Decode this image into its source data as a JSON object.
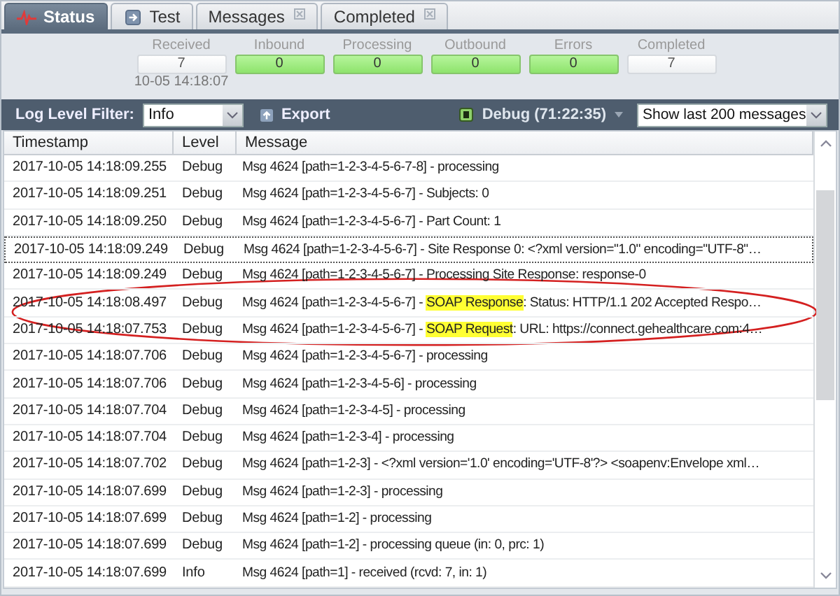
{
  "tabs": [
    {
      "label": "Status",
      "kind": "status",
      "closable": false,
      "selected": true
    },
    {
      "label": "Test",
      "kind": "test",
      "closable": false,
      "selected": false
    },
    {
      "label": "Messages",
      "kind": "plain",
      "closable": true,
      "selected": false
    },
    {
      "label": "Completed",
      "kind": "plain",
      "closable": true,
      "selected": false
    }
  ],
  "counters": [
    {
      "label": "Received",
      "value": "7",
      "highlighted": false,
      "time": "10-05 14:18:07"
    },
    {
      "label": "Inbound",
      "value": "0",
      "highlighted": true
    },
    {
      "label": "Processing",
      "value": "0",
      "highlighted": true
    },
    {
      "label": "Outbound",
      "value": "0",
      "highlighted": true
    },
    {
      "label": "Errors",
      "value": "0",
      "highlighted": true
    },
    {
      "label": "Completed",
      "value": "7",
      "highlighted": false
    }
  ],
  "toolbar": {
    "filter_label": "Log Level Filter:",
    "filter_value": "Info",
    "export_label": "Export",
    "debug_label": "Debug (71:22:35)",
    "limit_value": "Show last 200 messages"
  },
  "table": {
    "columns": [
      "Timestamp",
      "Level",
      "Message"
    ],
    "rows": [
      {
        "timestamp": "2017-10-05 14:18:09.255",
        "level": "Debug",
        "message": "Msg 4624 [path=1-2-3-4-5-6-7-8] - processing",
        "focused": false
      },
      {
        "timestamp": "2017-10-05 14:18:09.251",
        "level": "Debug",
        "message": "Msg 4624 [path=1-2-3-4-5-6-7] - Subjects: 0",
        "focused": false
      },
      {
        "timestamp": "2017-10-05 14:18:09.250",
        "level": "Debug",
        "message": "Msg 4624 [path=1-2-3-4-5-6-7] - Part Count: 1",
        "focused": false
      },
      {
        "timestamp": "2017-10-05 14:18:09.249",
        "level": "Debug",
        "message": "Msg 4624 [path=1-2-3-4-5-6-7] - Site Response 0: <?xml version=\"1.0\" encoding=\"UTF-8\"…",
        "focused": true
      },
      {
        "timestamp": "2017-10-05 14:18:09.249",
        "level": "Debug",
        "message": "Msg 4624 [path=1-2-3-4-5-6-7] - Processing Site Response: response-0",
        "focused": false
      },
      {
        "timestamp": "2017-10-05 14:18:08.497",
        "level": "Debug",
        "message": "Msg 4624 [path=1-2-3-4-5-6-7] - ",
        "highlight": "SOAP Response",
        "message_end": ": Status: HTTP/1.1 202 Accepted Respo…",
        "focused": false
      },
      {
        "timestamp": "2017-10-05 14:18:07.753",
        "level": "Debug",
        "message": "Msg 4624 [path=1-2-3-4-5-6-7] - ",
        "highlight": "SOAP Request",
        "message_end": ": URL: https://connect.gehealthcare.com:4…",
        "focused": false
      },
      {
        "timestamp": "2017-10-05 14:18:07.706",
        "level": "Debug",
        "message": "Msg 4624 [path=1-2-3-4-5-6-7] - processing",
        "focused": false
      },
      {
        "timestamp": "2017-10-05 14:18:07.706",
        "level": "Debug",
        "message": "Msg 4624 [path=1-2-3-4-5-6] - processing",
        "focused": false
      },
      {
        "timestamp": "2017-10-05 14:18:07.704",
        "level": "Debug",
        "message": "Msg 4624 [path=1-2-3-4-5] - processing",
        "focused": false
      },
      {
        "timestamp": "2017-10-05 14:18:07.704",
        "level": "Debug",
        "message": "Msg 4624 [path=1-2-3-4] - processing",
        "focused": false
      },
      {
        "timestamp": "2017-10-05 14:18:07.702",
        "level": "Debug",
        "message": "Msg 4624 [path=1-2-3] - <?xml version='1.0' encoding='UTF-8'?> <soapenv:Envelope xml…",
        "focused": false
      },
      {
        "timestamp": "2017-10-05 14:18:07.699",
        "level": "Debug",
        "message": "Msg 4624 [path=1-2-3] - processing",
        "focused": false
      },
      {
        "timestamp": "2017-10-05 14:18:07.699",
        "level": "Debug",
        "message": "Msg 4624 [path=1-2] - processing",
        "focused": false
      },
      {
        "timestamp": "2017-10-05 14:18:07.699",
        "level": "Debug",
        "message": "Msg 4624 [path=1-2] - processing queue (in: 0, prc: 1)",
        "focused": false
      },
      {
        "timestamp": "2017-10-05 14:18:07.699",
        "level": "Info",
        "message": "Msg 4624 [path=1] - received (rcvd: 7, in: 1)",
        "focused": false
      }
    ]
  }
}
